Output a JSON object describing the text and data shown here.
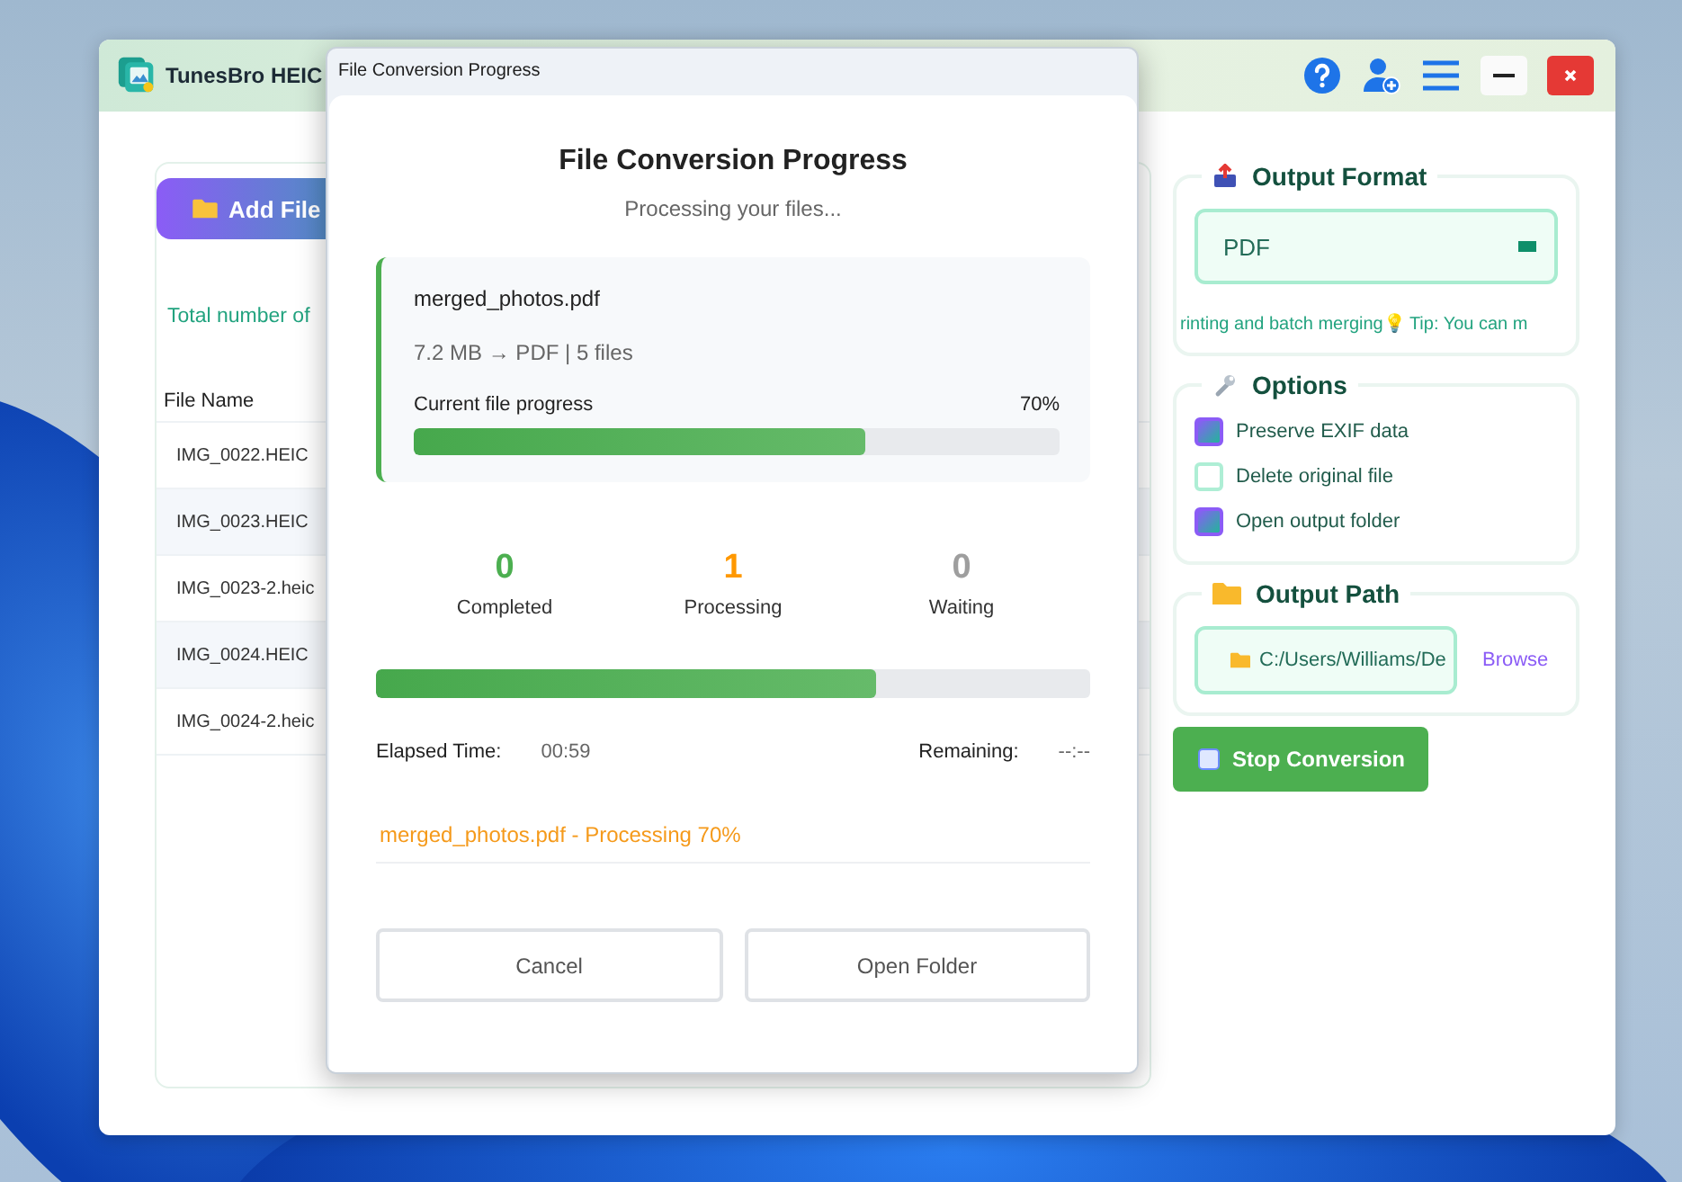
{
  "app": {
    "title": "TunesBro HEIC"
  },
  "files": {
    "add_button": "Add File",
    "total_label": "Total number of",
    "table": {
      "columns": [
        "File Name"
      ],
      "rows": [
        {
          "name": "IMG_0022.HEIC"
        },
        {
          "name": "IMG_0023.HEIC"
        },
        {
          "name": "IMG_0023-2.heic"
        },
        {
          "name": "IMG_0024.HEIC"
        },
        {
          "name": "IMG_0024-2.heic"
        }
      ]
    }
  },
  "output_format": {
    "title": "Output Format",
    "value": "PDF",
    "tip": "rinting and batch merging💡 Tip: You can m"
  },
  "options": {
    "title": "Options",
    "items": [
      {
        "label": "Preserve EXIF data",
        "checked": true
      },
      {
        "label": "Delete original file",
        "checked": false
      },
      {
        "label": "Open output folder",
        "checked": true
      }
    ]
  },
  "output_path": {
    "title": "Output Path",
    "path": "C:/Users/Williams/De",
    "browse": "Browse"
  },
  "stop_button": "Stop Conversion",
  "dialog": {
    "window_title": "File Conversion Progress",
    "heading": "File Conversion Progress",
    "subtitle": "Processing your files...",
    "current_file": {
      "name": "merged_photos.pdf",
      "meta": "7.2 MB → PDF | 5 files",
      "progress_label": "Current file progress",
      "percent": "70%",
      "level": 0.7
    },
    "stats": [
      {
        "count": "0",
        "label": "Completed",
        "color": "#4caf50"
      },
      {
        "count": "1",
        "label": "Processing",
        "color": "#ff9800"
      },
      {
        "count": "0",
        "label": "Waiting",
        "color": "#9e9e9e"
      }
    ],
    "overall": {
      "level": 0.7
    },
    "elapsed_label": "Elapsed Time:",
    "elapsed": "00:59",
    "remaining_label": "Remaining:",
    "remaining": "--:--",
    "status_line": "merged_photos.pdf - Processing 70%",
    "buttons": [
      "Cancel",
      "Open Folder"
    ]
  }
}
